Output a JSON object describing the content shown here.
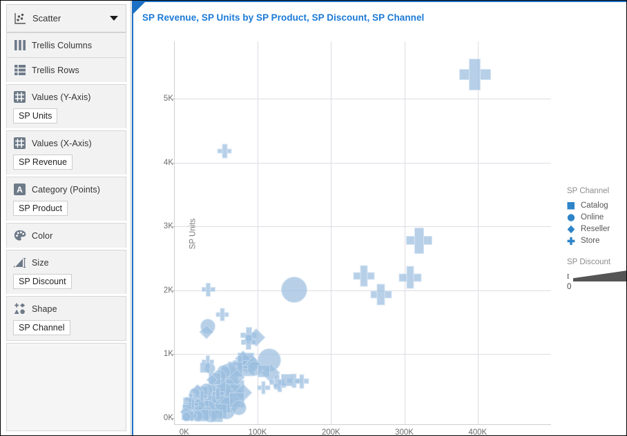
{
  "config_panel": {
    "viz_type": {
      "label": "Scatter",
      "icon": "scatter-chart-icon",
      "caret": "chevron-down-icon"
    },
    "shelves": [
      {
        "id": "trellis-columns",
        "label": "Trellis Columns",
        "icon": "trellis-columns-icon",
        "chip": null
      },
      {
        "id": "trellis-rows",
        "label": "Trellis Rows",
        "icon": "trellis-rows-icon",
        "chip": null
      },
      {
        "id": "values-y",
        "label": "Values (Y-Axis)",
        "icon": "measure-grid-icon",
        "chip": "SP Units"
      },
      {
        "id": "values-x",
        "label": "Values (X-Axis)",
        "icon": "measure-grid-icon",
        "chip": "SP Revenue"
      },
      {
        "id": "category-points",
        "label": "Category (Points)",
        "icon": "attribute-a-icon",
        "chip": "SP Product"
      },
      {
        "id": "color",
        "label": "Color",
        "icon": "palette-icon",
        "chip": null
      },
      {
        "id": "size",
        "label": "Size",
        "icon": "size-bars-icon",
        "chip": "SP Discount"
      },
      {
        "id": "shape",
        "label": "Shape",
        "icon": "shape-glyphs-icon",
        "chip": "SP Channel"
      }
    ]
  },
  "chart_panel": {
    "title": "SP Revenue, SP Units by SP Product, SP Discount, SP Channel",
    "accent_color": "#1b7ad6",
    "panel_border_color": "#1b6fc4"
  },
  "legend": {
    "shape_legend": {
      "title": "SP Channel",
      "color": "#2e84c8",
      "entries": [
        {
          "label": "Catalog",
          "shape": "square"
        },
        {
          "label": "Online",
          "shape": "circle"
        },
        {
          "label": "Reseller",
          "shape": "diamond"
        },
        {
          "label": "Store",
          "shape": "cross"
        }
      ]
    },
    "size_legend": {
      "title": "SP Discount",
      "min_label": "0",
      "max_label": "1",
      "wedge_color": "#555555"
    }
  },
  "chart_data": {
    "type": "scatter",
    "title": "SP Revenue, SP Units by SP Product, SP Discount, SP Channel",
    "xlabel": "",
    "ylabel": "SP Units",
    "xlim": [
      -13000,
      500000
    ],
    "ylim": [
      -100,
      5900
    ],
    "grid": true,
    "legend_position": "right",
    "marker_fill": "#9cbfe0",
    "marker_stroke": "#c8dcf0",
    "marker_opacity": 0.72,
    "x_ticks": [
      {
        "value": 0,
        "label": "0K"
      },
      {
        "value": 100000,
        "label": "100K"
      },
      {
        "value": 200000,
        "label": "200K"
      },
      {
        "value": 300000,
        "label": "300K"
      },
      {
        "value": 400000,
        "label": "400K"
      }
    ],
    "y_ticks": [
      {
        "value": 0,
        "label": "0K"
      },
      {
        "value": 1000,
        "label": "1K"
      },
      {
        "value": 2000,
        "label": "2K"
      },
      {
        "value": 3000,
        "label": "3K"
      },
      {
        "value": 4000,
        "label": "4K"
      },
      {
        "value": 5000,
        "label": "5K"
      }
    ],
    "encodings": {
      "x": "SP Revenue",
      "y": "SP Units",
      "shape": "SP Channel",
      "size": "SP Discount",
      "category": "SP Product"
    },
    "points": [
      {
        "x": 396000,
        "y": 5380,
        "shape": "cross",
        "size": 46
      },
      {
        "x": 55000,
        "y": 4180,
        "shape": "cross",
        "size": 21
      },
      {
        "x": 320000,
        "y": 2780,
        "shape": "cross",
        "size": 38
      },
      {
        "x": 245000,
        "y": 2220,
        "shape": "cross",
        "size": 31
      },
      {
        "x": 308000,
        "y": 2200,
        "shape": "cross",
        "size": 33
      },
      {
        "x": 268000,
        "y": 1930,
        "shape": "cross",
        "size": 31
      },
      {
        "x": 150000,
        "y": 2010,
        "shape": "circle",
        "size": 38
      },
      {
        "x": 33000,
        "y": 2010,
        "shape": "cross",
        "size": 20
      },
      {
        "x": 52000,
        "y": 1615,
        "shape": "cross",
        "size": 19
      },
      {
        "x": 32000,
        "y": 1435,
        "shape": "circle",
        "size": 22
      },
      {
        "x": 30000,
        "y": 1345,
        "shape": "diamond",
        "size": 19
      },
      {
        "x": 88000,
        "y": 1295,
        "shape": "cross",
        "size": 24
      },
      {
        "x": 98000,
        "y": 1265,
        "shape": "diamond",
        "size": 24
      },
      {
        "x": 88000,
        "y": 1255,
        "shape": "square",
        "size": 11
      },
      {
        "x": 88000,
        "y": 1185,
        "shape": "cross",
        "size": 22
      },
      {
        "x": 32000,
        "y": 880,
        "shape": "cross",
        "size": 18
      },
      {
        "x": 28000,
        "y": 790,
        "shape": "square",
        "size": 15
      },
      {
        "x": 35000,
        "y": 780,
        "shape": "circle",
        "size": 16
      },
      {
        "x": 80000,
        "y": 930,
        "shape": "diamond",
        "size": 22
      },
      {
        "x": 84000,
        "y": 895,
        "shape": "square",
        "size": 24
      },
      {
        "x": 76000,
        "y": 860,
        "shape": "cross",
        "size": 22
      },
      {
        "x": 88000,
        "y": 855,
        "shape": "circle",
        "size": 26
      },
      {
        "x": 94000,
        "y": 840,
        "shape": "diamond",
        "size": 22
      },
      {
        "x": 116000,
        "y": 905,
        "shape": "circle",
        "size": 34
      },
      {
        "x": 84000,
        "y": 790,
        "shape": "square",
        "size": 25
      },
      {
        "x": 96000,
        "y": 775,
        "shape": "circle",
        "size": 22
      },
      {
        "x": 70000,
        "y": 770,
        "shape": "square",
        "size": 22
      },
      {
        "x": 60000,
        "y": 730,
        "shape": "circle",
        "size": 23
      },
      {
        "x": 54000,
        "y": 720,
        "shape": "circle",
        "size": 20
      },
      {
        "x": 108000,
        "y": 735,
        "shape": "square",
        "size": 18
      },
      {
        "x": 118000,
        "y": 700,
        "shape": "diamond",
        "size": 26
      },
      {
        "x": 62000,
        "y": 660,
        "shape": "square",
        "size": 24
      },
      {
        "x": 72000,
        "y": 640,
        "shape": "diamond",
        "size": 22
      },
      {
        "x": 48000,
        "y": 650,
        "shape": "circle",
        "size": 20
      },
      {
        "x": 42000,
        "y": 610,
        "shape": "square",
        "size": 18
      },
      {
        "x": 38000,
        "y": 590,
        "shape": "diamond",
        "size": 16
      },
      {
        "x": 126000,
        "y": 560,
        "shape": "cross",
        "size": 22
      },
      {
        "x": 140000,
        "y": 590,
        "shape": "square",
        "size": 18
      },
      {
        "x": 150000,
        "y": 580,
        "shape": "cross",
        "size": 21
      },
      {
        "x": 160000,
        "y": 575,
        "shape": "cross",
        "size": 21
      },
      {
        "x": 130000,
        "y": 505,
        "shape": "cross",
        "size": 19
      },
      {
        "x": 108000,
        "y": 470,
        "shape": "cross",
        "size": 19
      },
      {
        "x": 62000,
        "y": 490,
        "shape": "diamond",
        "size": 28
      },
      {
        "x": 70000,
        "y": 455,
        "shape": "square",
        "size": 26
      },
      {
        "x": 54000,
        "y": 440,
        "shape": "circle",
        "size": 22
      },
      {
        "x": 46000,
        "y": 470,
        "shape": "square",
        "size": 22
      },
      {
        "x": 36000,
        "y": 455,
        "shape": "diamond",
        "size": 20
      },
      {
        "x": 30000,
        "y": 440,
        "shape": "circle",
        "size": 19
      },
      {
        "x": 24000,
        "y": 400,
        "shape": "square",
        "size": 19
      },
      {
        "x": 18000,
        "y": 430,
        "shape": "diamond",
        "size": 17
      },
      {
        "x": 14000,
        "y": 390,
        "shape": "circle",
        "size": 16
      },
      {
        "x": 80000,
        "y": 400,
        "shape": "diamond",
        "size": 24
      },
      {
        "x": 66000,
        "y": 350,
        "shape": "circle",
        "size": 30
      },
      {
        "x": 56000,
        "y": 330,
        "shape": "square",
        "size": 24
      },
      {
        "x": 44000,
        "y": 320,
        "shape": "diamond",
        "size": 22
      },
      {
        "x": 36000,
        "y": 300,
        "shape": "circle",
        "size": 20
      },
      {
        "x": 28000,
        "y": 285,
        "shape": "square",
        "size": 20
      },
      {
        "x": 20000,
        "y": 270,
        "shape": "diamond",
        "size": 18
      },
      {
        "x": 13000,
        "y": 250,
        "shape": "circle",
        "size": 18
      },
      {
        "x": 9000,
        "y": 300,
        "shape": "cross",
        "size": 16
      },
      {
        "x": 6000,
        "y": 230,
        "shape": "square",
        "size": 16
      },
      {
        "x": 62000,
        "y": 230,
        "shape": "circle",
        "size": 28
      },
      {
        "x": 52000,
        "y": 200,
        "shape": "square",
        "size": 24
      },
      {
        "x": 42000,
        "y": 190,
        "shape": "diamond",
        "size": 22
      },
      {
        "x": 33000,
        "y": 175,
        "shape": "circle",
        "size": 20
      },
      {
        "x": 25000,
        "y": 165,
        "shape": "square",
        "size": 20
      },
      {
        "x": 17000,
        "y": 150,
        "shape": "diamond",
        "size": 19
      },
      {
        "x": 11000,
        "y": 140,
        "shape": "circle",
        "size": 18
      },
      {
        "x": 5000,
        "y": 130,
        "shape": "square",
        "size": 16
      },
      {
        "x": 58000,
        "y": 120,
        "shape": "circle",
        "size": 26
      },
      {
        "x": 48000,
        "y": 105,
        "shape": "square",
        "size": 22
      },
      {
        "x": 39000,
        "y": 95,
        "shape": "diamond",
        "size": 21
      },
      {
        "x": 30000,
        "y": 85,
        "shape": "circle",
        "size": 19
      },
      {
        "x": 22000,
        "y": 75,
        "shape": "square",
        "size": 19
      },
      {
        "x": 15000,
        "y": 70,
        "shape": "diamond",
        "size": 18
      },
      {
        "x": 9000,
        "y": 60,
        "shape": "circle",
        "size": 17
      },
      {
        "x": 4000,
        "y": 55,
        "shape": "square",
        "size": 16
      },
      {
        "x": 2000,
        "y": 100,
        "shape": "diamond",
        "size": 15
      },
      {
        "x": 26000,
        "y": 40,
        "shape": "square",
        "size": 18
      },
      {
        "x": 18000,
        "y": 35,
        "shape": "circle",
        "size": 17
      },
      {
        "x": 11000,
        "y": 30,
        "shape": "diamond",
        "size": 16
      },
      {
        "x": 6000,
        "y": 25,
        "shape": "square",
        "size": 15
      },
      {
        "x": 3000,
        "y": 20,
        "shape": "circle",
        "size": 14
      },
      {
        "x": 36000,
        "y": 30,
        "shape": "circle",
        "size": 19
      },
      {
        "x": 44000,
        "y": 25,
        "shape": "square",
        "size": 18
      },
      {
        "x": 8000,
        "y": 180,
        "shape": "diamond",
        "size": 17
      },
      {
        "x": 12000,
        "y": 215,
        "shape": "cross",
        "size": 16
      },
      {
        "x": 20000,
        "y": 205,
        "shape": "circle",
        "size": 18
      },
      {
        "x": 46000,
        "y": 380,
        "shape": "cross",
        "size": 18
      },
      {
        "x": 24000,
        "y": 340,
        "shape": "cross",
        "size": 17
      },
      {
        "x": 72000,
        "y": 280,
        "shape": "square",
        "size": 22
      },
      {
        "x": 75000,
        "y": 160,
        "shape": "circle",
        "size": 22
      }
    ]
  }
}
